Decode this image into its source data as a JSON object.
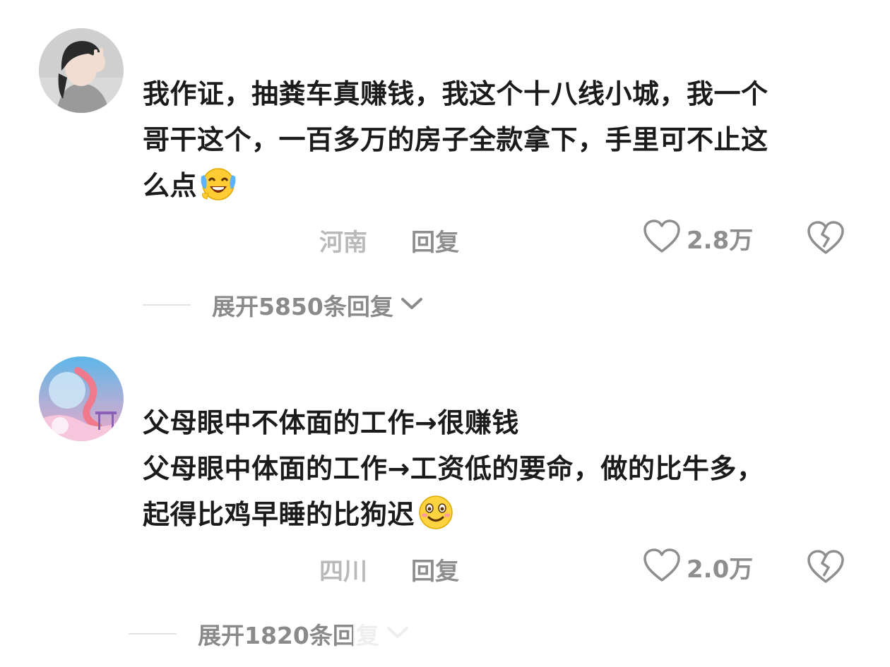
{
  "comments": [
    {
      "lines": [
        "我作证，抽粪车真赚钱，我这个十八线小城，我一个",
        "哥干这个，一百多万的房子全款拿下，手里可不止这",
        "么点"
      ],
      "emoji": "laughing-tears-emoji",
      "location": "河南",
      "reply_label": "回复",
      "likes": "2.8万",
      "expand_label": "展开5850条回复"
    },
    {
      "lines": [
        "父母眼中不体面的工作→很赚钱",
        "父母眼中体面的工作→工资低的要命，做的比牛多，",
        "起得比鸡早睡的比狗迟"
      ],
      "emoji": "smiling-face-emoji",
      "location": "四川",
      "reply_label": "回复",
      "likes": "2.0万",
      "expand_label": "展开1820条回复"
    }
  ],
  "icons": {
    "like": "heart-outline-icon",
    "dislike": "broken-heart-icon",
    "expand": "chevron-down-icon"
  },
  "colors": {
    "text": "#1b1b1b",
    "meta": "#8e8e8e",
    "location": "#b9b9b9"
  }
}
